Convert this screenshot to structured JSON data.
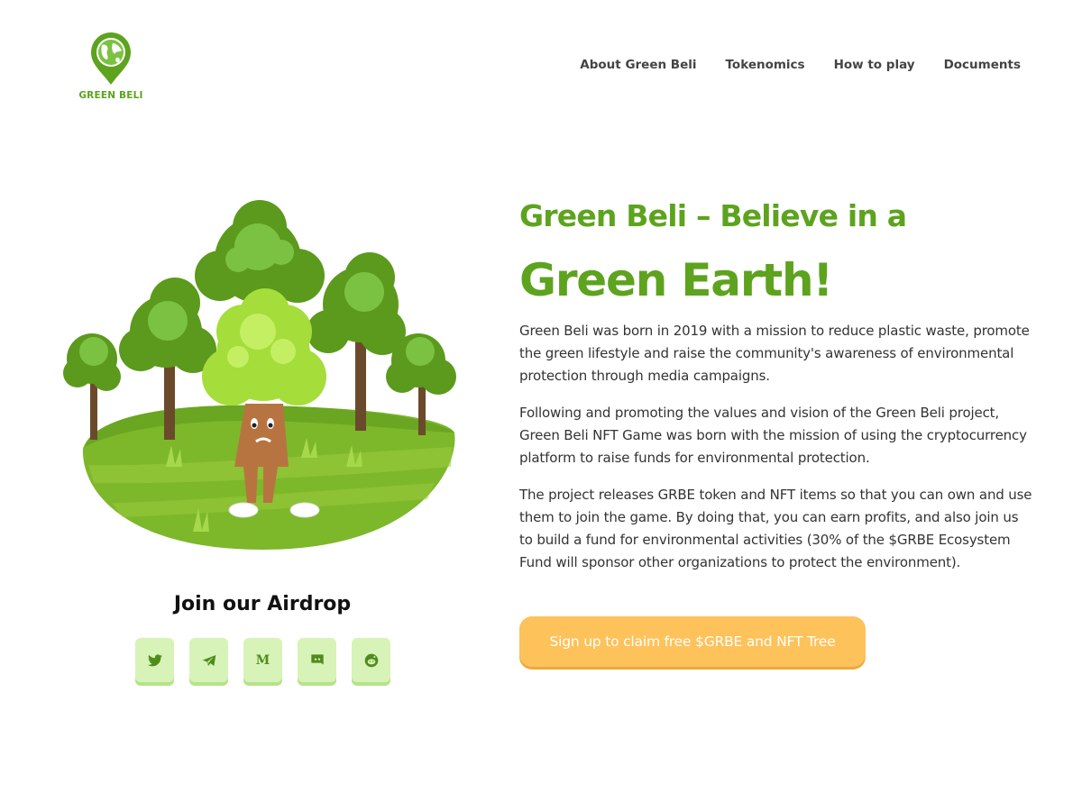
{
  "header": {
    "logo_text": "GREEN BELI",
    "nav": [
      {
        "label": "About Green Beli"
      },
      {
        "label": "Tokenomics"
      },
      {
        "label": "How to play"
      },
      {
        "label": "Documents"
      }
    ]
  },
  "hero": {
    "title_line1": "Green Beli – Believe in a",
    "title_line2": "Green Earth!",
    "paragraphs": [
      "Green Beli was born in 2019 with a mission to reduce plastic waste, promote the green lifestyle and raise the community's awareness of environmental protection through media campaigns.",
      "Following and promoting the values and vision of the Green Beli project, Green Beli NFT Game was born with the mission of using the cryptocurrency platform to raise funds for environmental protection.",
      "The project releases GRBE token and NFT items so that you can own and use them to join the game. By doing that, you can earn profits, and also join us to build a fund for environmental activities (30% of the $GRBE Ecosystem Fund will sponsor other organizations to protect the environment)."
    ],
    "cta_label": "Sign up to claim free $GRBE and NFT Tree"
  },
  "airdrop": {
    "title": "Join our Airdrop",
    "socials": [
      {
        "icon": "twitter-icon"
      },
      {
        "icon": "telegram-icon"
      },
      {
        "icon": "medium-icon",
        "glyph": "M"
      },
      {
        "icon": "discord-icon"
      },
      {
        "icon": "reddit-icon"
      }
    ]
  },
  "colors": {
    "brand_green": "#5da31e",
    "cta_yellow": "#fdc25a",
    "social_bg": "#d8f3b8"
  }
}
